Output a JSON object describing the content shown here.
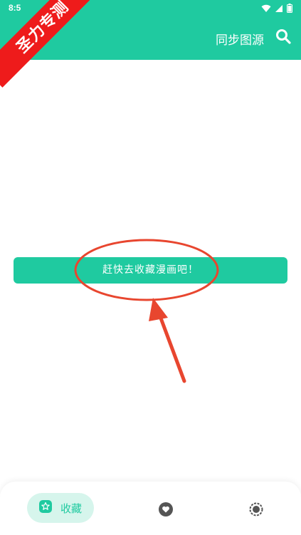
{
  "status_bar": {
    "time": "8:5",
    "icons": [
      "wifi-icon",
      "signal-icon",
      "battery-icon"
    ]
  },
  "header": {
    "sync_label": "同步图源",
    "search_icon": "search-icon"
  },
  "watermark": {
    "text": "圣力专测"
  },
  "empty_state": {
    "cta_label": "赶快去收藏漫画吧！"
  },
  "bottom_nav": {
    "items": [
      {
        "label": "收藏",
        "icon": "star-badge-icon",
        "selected": true
      },
      {
        "label": "",
        "icon": "heart-icon",
        "selected": false
      },
      {
        "label": "",
        "icon": "gear-icon",
        "selected": false
      }
    ]
  },
  "colors": {
    "accent": "#1fcaa0",
    "selected_bg": "#d6f5ec",
    "annotation": "#e8462f",
    "watermark": "#ee1b1b"
  }
}
